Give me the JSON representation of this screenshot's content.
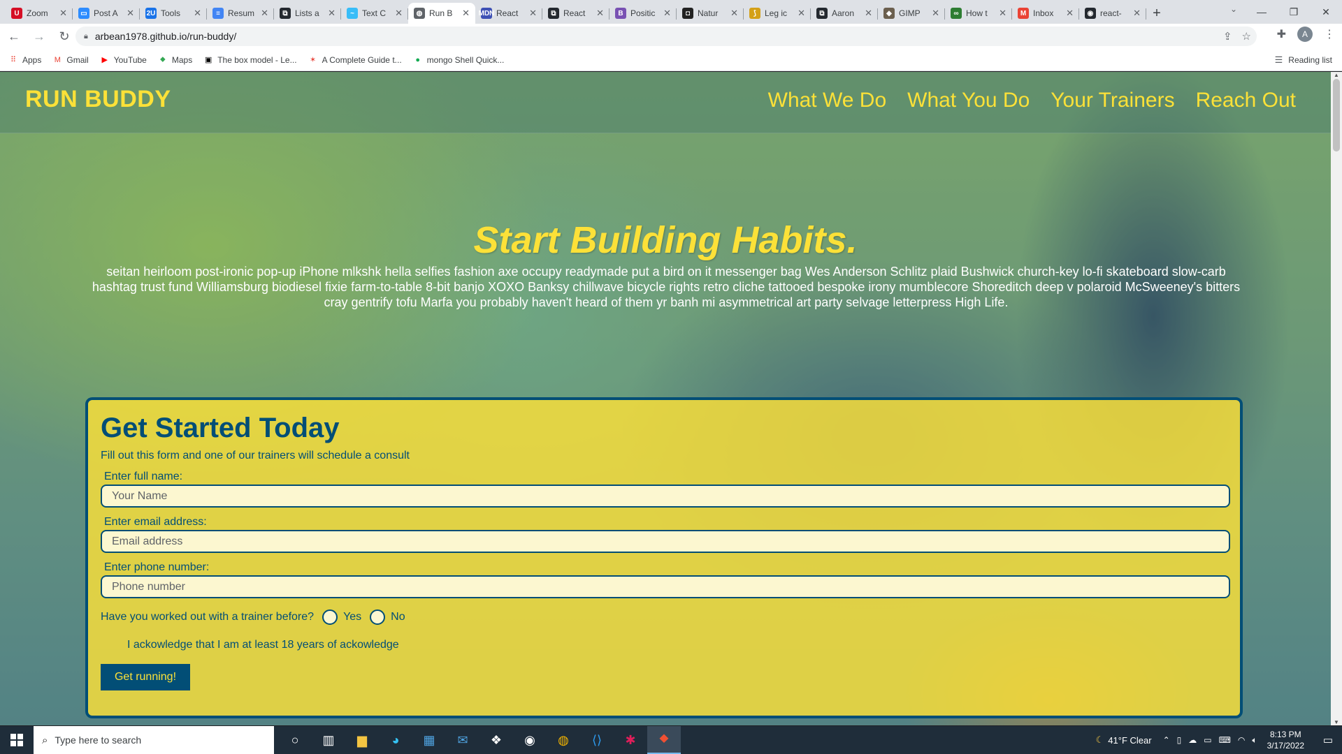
{
  "browser": {
    "tabs": [
      {
        "title": "Zoom",
        "icon": "U",
        "color": "#d50f25"
      },
      {
        "title": "Post A",
        "icon": "▭",
        "color": "#2d8cff"
      },
      {
        "title": "Tools",
        "icon": "2U",
        "color": "#1a73e8"
      },
      {
        "title": "Resum",
        "icon": "≡",
        "color": "#4285f4"
      },
      {
        "title": "Lists a",
        "icon": "⧉",
        "color": "#24292f"
      },
      {
        "title": "Text C",
        "icon": "~",
        "color": "#38bdf8"
      },
      {
        "title": "Run B",
        "icon": "◍",
        "color": "#5f6368",
        "active": true
      },
      {
        "title": "React",
        "icon": "MDN",
        "color": "#3f51b5"
      },
      {
        "title": "React",
        "icon": "⧉",
        "color": "#24292f"
      },
      {
        "title": "Positic",
        "icon": "B",
        "color": "#7952b3"
      },
      {
        "title": "Natur",
        "icon": "◘",
        "color": "#222222"
      },
      {
        "title": "Leg ic",
        "icon": "⟆",
        "color": "#d4a017"
      },
      {
        "title": "Aaron",
        "icon": "⧉",
        "color": "#24292f"
      },
      {
        "title": "GIMP",
        "icon": "◆",
        "color": "#6b5f4e"
      },
      {
        "title": "How t",
        "icon": "∞",
        "color": "#2e7d32"
      },
      {
        "title": "Inbox",
        "icon": "M",
        "color": "#ea4335"
      },
      {
        "title": "react-",
        "icon": "◉",
        "color": "#24292f"
      }
    ],
    "url": "arbean1978.github.io/run-buddy/",
    "bookmarks": [
      {
        "label": "Apps",
        "icon": "⠿",
        "color": "#ea4335"
      },
      {
        "label": "Gmail",
        "icon": "M",
        "color": "#ea4335"
      },
      {
        "label": "YouTube",
        "icon": "▶",
        "color": "#ff0000"
      },
      {
        "label": "Maps",
        "icon": "⬥",
        "color": "#34a853"
      },
      {
        "label": "The box model - Le...",
        "icon": "▣",
        "color": "#000000"
      },
      {
        "label": "A Complete Guide t...",
        "icon": "✶",
        "color": "#e8453c"
      },
      {
        "label": "mongo Shell Quick...",
        "icon": "●",
        "color": "#13aa52"
      }
    ],
    "reading_list": "Reading list",
    "profile_initial": "A"
  },
  "site": {
    "logo": "RUN BUDDY",
    "nav": [
      "What We Do",
      "What You Do",
      "Your Trainers",
      "Reach Out"
    ],
    "hero_title": "Start Building Habits.",
    "hero_text": "seitan heirloom post-ironic pop-up iPhone mlkshk hella selfies fashion axe occupy readymade put a bird on it messenger bag Wes Anderson Schlitz plaid Bushwick church-key lo-fi skateboard slow-carb hashtag trust fund Williamsburg biodiesel fixie farm-to-table 8-bit banjo XOXO Banksy chillwave bicycle rights retro cliche tattooed bespoke irony mumblecore Shoreditch deep v polaroid McSweeney's bitters cray gentrify tofu Marfa you probably haven't heard of them yr banh mi asymmetrical art party selvage letterpress High Life.",
    "form": {
      "title": "Get Started Today",
      "subtitle": "Fill out this form and one of our trainers will schedule a consult",
      "name_label": "Enter full name:",
      "name_placeholder": "Your Name",
      "email_label": "Enter email address:",
      "email_placeholder": "Email address",
      "phone_label": "Enter phone number:",
      "phone_placeholder": "Phone number",
      "trainer_question": "Have you worked out with a trainer before?",
      "yes_label": "Yes",
      "no_label": "No",
      "acknowledge": "I ackowledge that I am at least 18 years of ackowledge",
      "submit_label": "Get running!"
    },
    "colors": {
      "accent": "#fce138",
      "primary": "#024e76"
    }
  },
  "taskbar": {
    "search_placeholder": "Type here to search",
    "weather": "41°F  Clear",
    "time": "8:13 PM",
    "date": "3/17/2022"
  }
}
